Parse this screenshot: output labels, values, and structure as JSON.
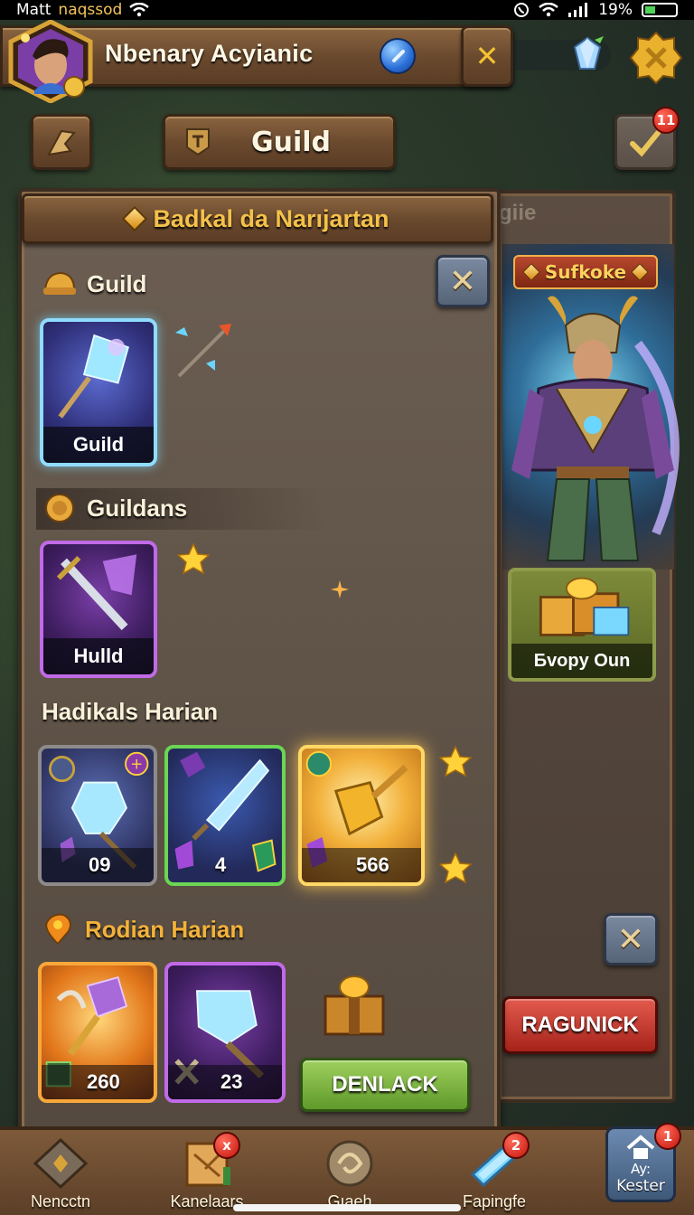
{
  "status_bar": {
    "carrier_prefix": "Matt",
    "carrier_name": "naqssod",
    "battery": "19%"
  },
  "header": {
    "player_name": "Nbenary Acyianic",
    "guild_tab_label": "Guild",
    "quest_badge_count": "11"
  },
  "main_panel": {
    "title": "Badkal da Narıjartan",
    "sections": {
      "guild": {
        "heading": "Guild",
        "card_label": "Guild"
      },
      "guildans": {
        "heading": "Guildans",
        "card_label": "Hulld"
      },
      "hadikals": {
        "heading": "Hadikals Harian",
        "items": [
          {
            "qty": "09"
          },
          {
            "qty": "4"
          },
          {
            "qty": "566"
          }
        ]
      },
      "rodian": {
        "heading": "Rodian Harian",
        "items": [
          {
            "qty": "260"
          },
          {
            "qty": "23"
          }
        ],
        "action_button": "DENLACK"
      }
    }
  },
  "side_panel": {
    "title": "giie",
    "hero_tag": "Sufkoke",
    "bundle_label": "Бvopy Oun",
    "action_button": "RAGUNICK"
  },
  "bottom_nav": {
    "items": [
      {
        "label": "Nencctn",
        "badge": ""
      },
      {
        "label": "Kanelaars",
        "badge": "x"
      },
      {
        "label": "Gıaeh",
        "badge": ""
      },
      {
        "label": "Fapingfe",
        "badge": "2"
      }
    ],
    "home": {
      "label_top": "Ay:",
      "label": "Kester",
      "badge": "1"
    }
  },
  "colors": {
    "title_gold": "#f4c14a",
    "card_blue_border": "#8fdcff",
    "card_purple_border": "#c16ae8",
    "card_gold_border": "#ffd866",
    "button_green": "#5f9a2a",
    "button_red": "#a6231a",
    "badge_red": "#c4150b"
  }
}
